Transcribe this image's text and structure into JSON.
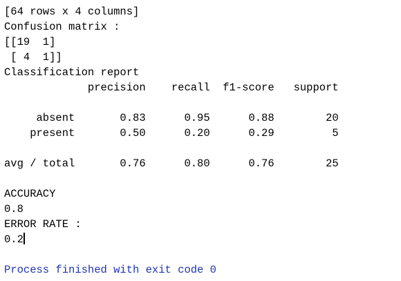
{
  "console": {
    "lines": [
      "[64 rows x 4 columns]",
      "Confusion matrix :",
      "[[19  1]",
      " [ 4  1]]",
      "Classification report",
      "             precision    recall  f1-score   support",
      "",
      "     absent       0.83      0.95      0.88        20",
      "    present       0.50      0.20      0.29         5",
      "",
      "avg / total       0.76      0.80      0.76        25",
      "",
      "ACCURACY",
      "0.8",
      "ERROR RATE :",
      "0.2",
      "",
      "Process finished with exit code 0"
    ]
  },
  "colors": {
    "output_text": "#000000",
    "process_message": "#1f34b0",
    "background": "#ffffff"
  }
}
